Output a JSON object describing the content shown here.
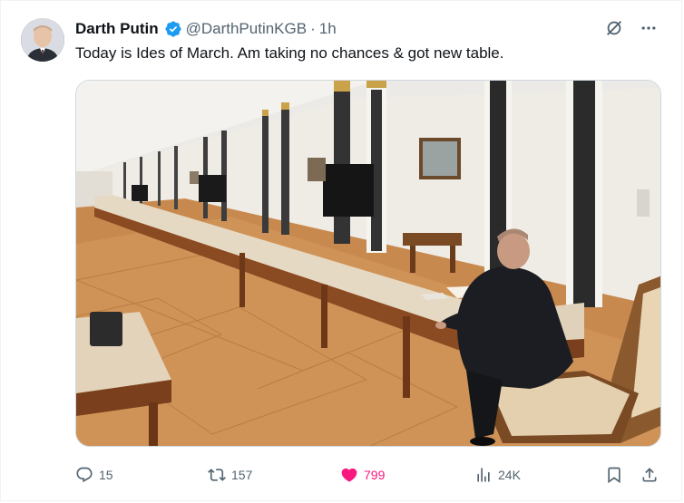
{
  "author": {
    "name": "Darth Putin",
    "handle": "@DarthPutinKGB",
    "separator": "·",
    "time": "1h",
    "verified": true
  },
  "tweet": {
    "text": "Today is Ides of March. Am taking no chances & got new table."
  },
  "media": {
    "description_icon": "photo"
  },
  "actions": {
    "replies": "15",
    "retweets": "157",
    "likes": "799",
    "views": "24K"
  },
  "colors": {
    "verified": "#1d9bf0",
    "like_active": "#f91880",
    "muted": "#536471"
  }
}
